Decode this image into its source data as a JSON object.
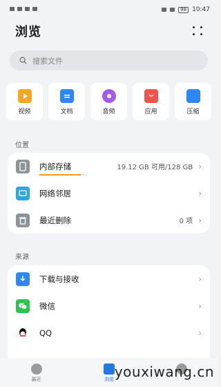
{
  "status_bar": {
    "battery": "98",
    "time": "10:47"
  },
  "header": {
    "title": "浏览"
  },
  "search": {
    "placeholder": "搜索文件"
  },
  "categories": [
    {
      "label": "视频",
      "icon": "video-icon",
      "color": "#f5a623"
    },
    {
      "label": "文档",
      "icon": "document-icon",
      "color": "#2f86f6"
    },
    {
      "label": "音频",
      "icon": "audio-icon",
      "color": "#a55be8"
    },
    {
      "label": "应用",
      "icon": "app-icon",
      "color": "#f2544b"
    },
    {
      "label": "压缩",
      "icon": "archive-icon",
      "color": "#2f86f6"
    }
  ],
  "location": {
    "section_label": "位置",
    "internal_storage": {
      "label": "内部存储",
      "value": "19.12 GB 可用/128 GB",
      "usage": 0.85
    },
    "network_neighbors": {
      "label": "网络邻居"
    },
    "recently_deleted": {
      "label": "最近删除",
      "value": "0 项"
    }
  },
  "sources": {
    "section_label": "来源",
    "items": [
      {
        "label": "下载与接收",
        "icon": "download-icon"
      },
      {
        "label": "微信",
        "icon": "wechat-icon"
      },
      {
        "label": "QQ",
        "icon": "qq-icon"
      }
    ]
  },
  "bottom_nav": {
    "items": [
      {
        "label": "最近"
      },
      {
        "label": "浏览"
      },
      {
        "label": ""
      }
    ]
  },
  "watermark": "youxiwang.cn",
  "colors": {
    "accent": "#2577e3",
    "storage_bar": "#f59a23"
  }
}
